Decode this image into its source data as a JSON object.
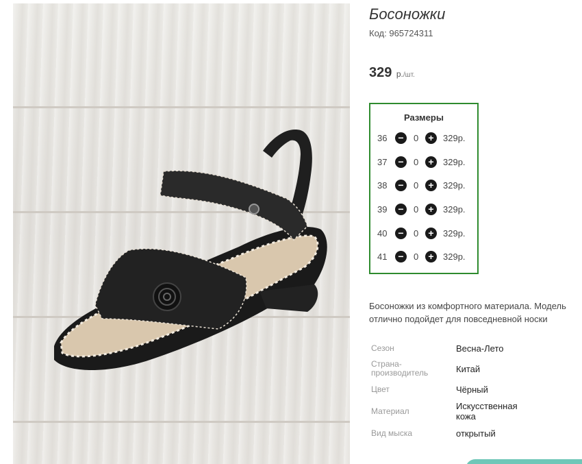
{
  "product": {
    "title": "Босоножки",
    "code_label": "Код:",
    "code_value": "965724311",
    "price_value": "329",
    "price_unit": "р.",
    "price_per": "/шт."
  },
  "sizes": {
    "title": "Размеры",
    "minus_icon": "−",
    "plus_icon": "+",
    "rows": [
      {
        "size": "36",
        "qty": "0",
        "price": "329р."
      },
      {
        "size": "37",
        "qty": "0",
        "price": "329р."
      },
      {
        "size": "38",
        "qty": "0",
        "price": "329р."
      },
      {
        "size": "39",
        "qty": "0",
        "price": "329р."
      },
      {
        "size": "40",
        "qty": "0",
        "price": "329р."
      },
      {
        "size": "41",
        "qty": "0",
        "price": "329р."
      }
    ]
  },
  "description": "Босоножки из комфортного материала. Модель отлично подойдет для повседневной носки",
  "specs": [
    {
      "label": "Сезон",
      "value": "Весна-Лето"
    },
    {
      "label": "Страна-производитель",
      "value": "Китай"
    },
    {
      "label": "Цвет",
      "value": "Чёрный"
    },
    {
      "label": "Материал",
      "value": "Искусственная кожа"
    },
    {
      "label": "Вид мыска",
      "value": "открытый"
    }
  ],
  "colors": {
    "sizes_border": "#2e8b2e",
    "accent": "#6fc7b8"
  }
}
